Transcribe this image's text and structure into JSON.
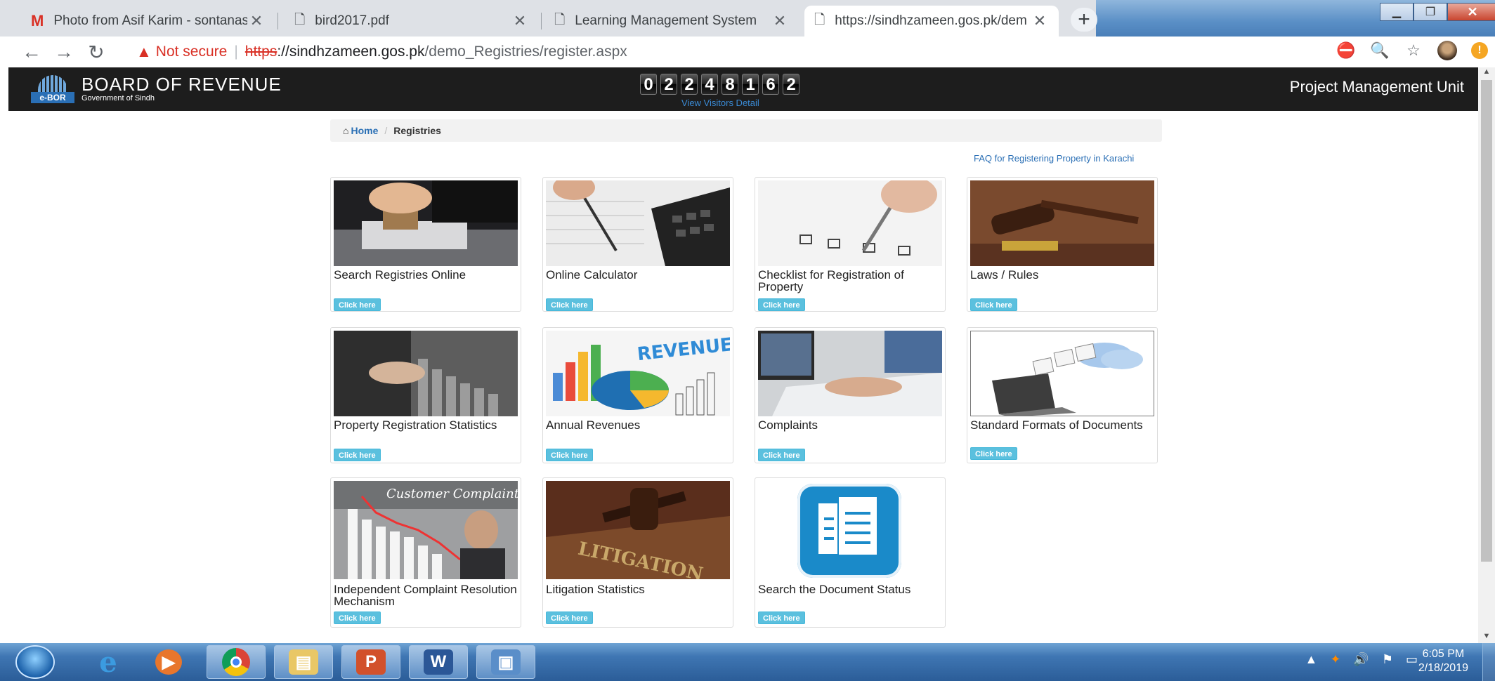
{
  "browser": {
    "tabs": [
      {
        "title": "Photo from Asif Karim - sontanas",
        "icon": "gmail-icon"
      },
      {
        "title": "bird2017.pdf",
        "icon": "document-icon"
      },
      {
        "title": "Learning Management System",
        "icon": "document-icon"
      },
      {
        "title": "https://sindhzameen.gos.pk/dem",
        "icon": "document-icon"
      }
    ],
    "new_tab": "+",
    "close_glyph": "✕",
    "security_label": "Not secure",
    "url": {
      "scheme": "https",
      "rest_host": "://sindhzameen.gos.pk",
      "path": "/demo_Registries/register.aspx"
    }
  },
  "site": {
    "brand_title": "BOARD OF REVENUE",
    "brand_sub": "Government of Sindh",
    "logo_text": "e-BOR",
    "visitor_digits": [
      "0",
      "2",
      "2",
      "4",
      "8",
      "1",
      "6",
      "2"
    ],
    "visitors_link": "View Visitors Detail",
    "unit_name": "Project Management Unit"
  },
  "breadcrumb": {
    "home": "Home",
    "current": "Registries"
  },
  "faq_link": "FAQ for Registering Property in Karachi",
  "cards": [
    {
      "title": "Search Registries Online",
      "button": "Click here",
      "image": "stamp-photo"
    },
    {
      "title": "Online Calculator",
      "button": "Click here",
      "image": "calculator-photo"
    },
    {
      "title": "Checklist for Registration of Property",
      "button": "Click here",
      "image": "checklist-photo"
    },
    {
      "title": "Laws / Rules",
      "button": "Click here",
      "image": "gavel-photo"
    },
    {
      "title": "Property Registration Statistics",
      "button": "Click here",
      "image": "statistics-photo"
    },
    {
      "title": "Annual Revenues",
      "button": "Click here",
      "image": "revenue-photo",
      "image_text": "REVENUE"
    },
    {
      "title": "Complaints",
      "button": "Click here",
      "image": "typing-photo"
    },
    {
      "title": "Standard Formats of Documents",
      "button": "Click here",
      "image": "cloud-laptop-illustration"
    },
    {
      "title": "Independent Complaint Resolution Mechanism",
      "button": "Click here",
      "image": "complaint-chart-photo",
      "image_text": "Customer Complaint"
    },
    {
      "title": "Litigation Statistics",
      "button": "Click here",
      "image": "litigation-photo",
      "image_text": "LITIGATION"
    },
    {
      "title": "Search the Document Status",
      "button": "Click here",
      "image": "documents-icon"
    }
  ],
  "taskbar": {
    "apps": [
      "internet-explorer-icon",
      "media-player-icon",
      "chrome-icon",
      "file-explorer-icon",
      "powerpoint-icon",
      "word-icon",
      "picture-viewer-icon"
    ],
    "time": "6:05 PM",
    "date": "2/18/2019"
  },
  "colors": {
    "header_bg": "#1d1d1d",
    "link": "#2a6fb5",
    "button": "#5bc0de",
    "warning": "#d93025"
  }
}
